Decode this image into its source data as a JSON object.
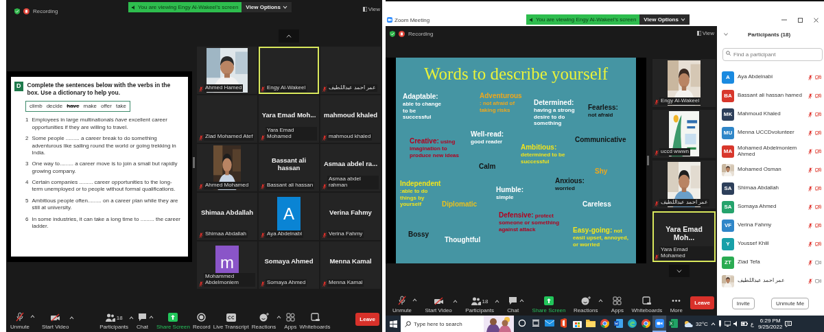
{
  "left_window": {
    "recording_label": "Recording",
    "banner": "You are viewing Engy Al-Wakeel's screen",
    "view_options": "View Options",
    "view_button": "View",
    "worksheet": {
      "badge": "D",
      "instruction": "Complete the sentences below with the verbs in the box. Use a dictionary to help you.",
      "verbs": [
        {
          "word": "climb",
          "struck": false
        },
        {
          "word": "decide",
          "struck": false
        },
        {
          "word": "have",
          "struck": true
        },
        {
          "word": "make",
          "struck": false
        },
        {
          "word": "offer",
          "struck": false
        },
        {
          "word": "take",
          "struck": false
        }
      ],
      "sentences": [
        {
          "number": "1",
          "text": "Employees in large multinationals *have* excellent career opportunities if they are willing to travel."
        },
        {
          "number": "2",
          "text": "Some people ......... a career break to do something adventurous like sailing round the world or going trekking in India."
        },
        {
          "number": "3",
          "text": "One way to......... a career move is to join a small but rapidly growing company."
        },
        {
          "number": "4",
          "text": "Certain companies ......... career opportunities to the long-term unemployed or to people without formal qualifications."
        },
        {
          "number": "5",
          "text": "Ambitious people often......... on a career plan while they are still at university."
        },
        {
          "number": "6",
          "text": "In some industries, it can take a long time to ......... the career ladder."
        }
      ]
    },
    "tiles": [
      {
        "name": "Ahmed Hamed",
        "active": false
      },
      {
        "kind": "blank",
        "name": "Engy Al-Wakeel",
        "active": true
      },
      {
        "kind": "blank",
        "name": "عمر احمد عبداللطيف",
        "active": false
      },
      {
        "kind": "blank",
        "name": "Ziad Mohamed Atef",
        "active": false
      },
      {
        "kind": "name",
        "display": "Yara Emad Moh...",
        "name": "Yara Emad Mohamed",
        "active": false
      },
      {
        "kind": "name",
        "display": "mahmoud khaled",
        "name": "mahmoud khaled",
        "active": false
      },
      {
        "name": "Ahmed Mohamed",
        "active": false
      },
      {
        "kind": "name",
        "display": "Bassant ali hassan",
        "name": "Bassant ali hassan",
        "active": false
      },
      {
        "kind": "name",
        "display": "Asmaa abdel ra...",
        "name": "Asmaa abdel rahman",
        "active": false
      },
      {
        "kind": "name",
        "display": "Shimaa Abdallah",
        "name": "Shimaa Abdallah",
        "active": false
      },
      {
        "kind": "avatar",
        "letter": "A",
        "color": "#0a84d4",
        "name": "Aya Abdelnabi",
        "active": false
      },
      {
        "kind": "name",
        "display": "Verina Fahmy",
        "name": "Verina Fahmy",
        "active": false
      },
      {
        "kind": "avatar",
        "letter": "m",
        "color": "#8a55c8",
        "name": "Mohammed Abdelmoniem",
        "active": false
      },
      {
        "kind": "name",
        "display": "Somaya Ahmed",
        "name": "Somaya Ahmed",
        "active": false
      },
      {
        "kind": "name",
        "display": "Menna Kamal",
        "name": "Menna Kamal",
        "active": false
      }
    ],
    "toolbar": [
      {
        "kind": "mic",
        "label": "Unmute",
        "caret": true
      },
      {
        "kind": "video",
        "label": "Start Video",
        "caret": true
      },
      {
        "kind": "participants",
        "label": "Participants",
        "count": "18",
        "caret": true
      },
      {
        "kind": "chat",
        "label": "Chat",
        "caret": true
      },
      {
        "kind": "share",
        "label": "Share Screen",
        "caret": false
      },
      {
        "kind": "record",
        "label": "Record",
        "caret": false
      },
      {
        "kind": "transcript",
        "label": "Live Transcript",
        "caret": false
      },
      {
        "kind": "reactions",
        "label": "Reactions",
        "caret": true
      },
      {
        "kind": "apps",
        "label": "Apps",
        "caret": false
      },
      {
        "kind": "whiteboard",
        "label": "Whiteboards",
        "caret": false
      },
      {
        "kind": "leave",
        "label": "Leave",
        "caret": false
      }
    ]
  },
  "right_window": {
    "title": "Zoom Meeting",
    "banner": "You are viewing Engy Al-Wakeel's screen",
    "view_options": "View Options",
    "recording_label": "Recording",
    "view_button": "View",
    "slide": {
      "title": "Words to describe yourself",
      "items": [
        {
          "kind": "stacked",
          "term": "Adaptable:",
          "definition": "able to change to be successful",
          "color": "#ffffff"
        },
        {
          "kind": "stacked",
          "term": "Adventurous",
          "definition": ": not afraid of taking risks",
          "color": "#f0a81c"
        },
        {
          "kind": "stacked",
          "term": "Determined:",
          "definition": "having a strong desire to do something",
          "color": "#ffffff"
        },
        {
          "kind": "stacked",
          "term": "Fearless:",
          "definition": "not afraid",
          "color": "#141414"
        },
        {
          "kind": "inline",
          "term": "Creative:",
          "definition": "using imagination to produce new ideas",
          "color": "#b3001e"
        },
        {
          "kind": "stacked",
          "term": "Well-read:",
          "definition": "good reader",
          "color": "#ffffff"
        },
        {
          "kind": "stacked",
          "term": "Ambitious:",
          "definition": "determined to be successful",
          "color": "#f2e41c"
        },
        {
          "kind": "stacked",
          "term": "Communicative",
          "color": "#141414"
        },
        {
          "kind": "stacked",
          "term": "Calm",
          "color": "#141414"
        },
        {
          "kind": "stacked",
          "term": "Shy",
          "color": "#f0a81c"
        },
        {
          "kind": "stacked",
          "term": "Independent",
          "definition": ":able to do things by yourself",
          "color": "#f2e41c"
        },
        {
          "kind": "stacked",
          "term": "Diplomatic",
          "color": "#e8c020"
        },
        {
          "kind": "stacked",
          "term": "Humble:",
          "definition": "simple",
          "color": "#ffffff"
        },
        {
          "kind": "stacked",
          "term": "Anxious:",
          "definition": "worried",
          "color": "#141414"
        },
        {
          "kind": "stacked",
          "term": "Careless",
          "color": "#ffffff"
        },
        {
          "kind": "stacked",
          "term": "Bossy",
          "color": "#141414"
        },
        {
          "kind": "stacked",
          "term": "Thoughtful",
          "color": "#ffffff"
        },
        {
          "kind": "inline",
          "term": "Defensive:",
          "definition": "protect someone or something against attack",
          "color": "#b3001e"
        },
        {
          "kind": "inline",
          "term": "Easy-going:",
          "definition": "not easil upset, annoyed, or worried",
          "color": "#f2e41c"
        }
      ]
    },
    "tiles": [
      {
        "name": "Engy Al-Wakeel",
        "active": false
      },
      {
        "kind": "poster",
        "name": "uccd wwwn",
        "active": false
      },
      {
        "name": "عمر احمد عبداللطيف",
        "active": false
      },
      {
        "kind": "name",
        "display": "Yara Emad Moh...",
        "name": "Yara Emad Mohamed",
        "active": true
      }
    ],
    "toolbar": [
      {
        "kind": "mic",
        "label": "Unmute",
        "caret": true
      },
      {
        "kind": "video",
        "label": "Start Video",
        "caret": true
      },
      {
        "kind": "participants",
        "label": "Participants",
        "count": "18",
        "caret": true
      },
      {
        "kind": "chat",
        "label": "Chat",
        "caret": true
      },
      {
        "kind": "share",
        "label": "Share Screen",
        "caret": false
      },
      {
        "kind": "reactions",
        "label": "Reactions",
        "caret": true
      },
      {
        "kind": "apps",
        "label": "Apps",
        "caret": false
      },
      {
        "kind": "whiteboard",
        "label": "Whiteboards",
        "caret": false
      },
      {
        "kind": "more",
        "label": "More",
        "caret": false
      },
      {
        "kind": "leave",
        "label": "Leave",
        "caret": false
      }
    ],
    "participants": {
      "title": "Participants (18)",
      "search_placeholder": "Find a participant",
      "rows": [
        {
          "kind": "initials",
          "initials": "A",
          "color": "#1a8ae0",
          "name": "Aya Abdelnabi",
          "video_off": true
        },
        {
          "kind": "initials",
          "initials": "BA",
          "color": "#d8372c",
          "name": "Bassant ali hassan hamed",
          "video_off": true
        },
        {
          "kind": "initials",
          "initials": "MK",
          "color": "#2d3f5a",
          "name": "Mahmoud Khaled",
          "video_off": true
        },
        {
          "kind": "initials",
          "initials": "MU",
          "color": "#2f86c8",
          "name": "Menna UCCDvolunteer",
          "video_off": true
        },
        {
          "kind": "initials",
          "initials": "MA",
          "color": "#d8372c",
          "name": "Mohamed Abdelmoniem Ahmed",
          "video_off": true
        },
        {
          "name": "Mohamed Osman",
          "video_off": true
        },
        {
          "kind": "initials",
          "initials": "SA",
          "color": "#2d3f5a",
          "name": "Shimaa Abdallah",
          "video_off": true
        },
        {
          "kind": "initials",
          "initials": "SA",
          "color": "#25a36c",
          "name": "Somaya Ahmed",
          "video_off": true
        },
        {
          "kind": "initials",
          "initials": "VF",
          "color": "#2f86c8",
          "name": "Verina Fahmy",
          "video_off": true
        },
        {
          "kind": "initials",
          "initials": "Y",
          "color": "#17a0a8",
          "name": "Youssef Khlil",
          "video_off": true
        },
        {
          "kind": "initials",
          "initials": "ZT",
          "color": "#2aab52",
          "name": "Ziad Tefa",
          "video_off": false
        },
        {
          "name": "عمر احمد عبداللطيف",
          "video_off": false
        }
      ],
      "buttons": [
        "Invite",
        "Unmute Me"
      ]
    }
  },
  "taskbar": {
    "search_placeholder": "Type here to search",
    "apps": [
      {
        "kind": "cortana",
        "active": false
      },
      {
        "kind": "taskview",
        "active": false
      },
      {
        "kind": "mail",
        "active": false
      },
      {
        "kind": "office",
        "active": false
      },
      {
        "kind": "store",
        "active": false
      },
      {
        "kind": "explorer",
        "active": false
      },
      {
        "kind": "chrome",
        "active": false
      },
      {
        "kind": "word",
        "active": false
      },
      {
        "kind": "edge",
        "active": false
      },
      {
        "kind": "chrome",
        "active": false
      },
      {
        "kind": "zoom",
        "active": true
      },
      {
        "kind": "excel",
        "active": false
      }
    ],
    "temperature": "32°C",
    "language": "ع",
    "time": "6:29 PM",
    "date": "9/25/2022"
  }
}
